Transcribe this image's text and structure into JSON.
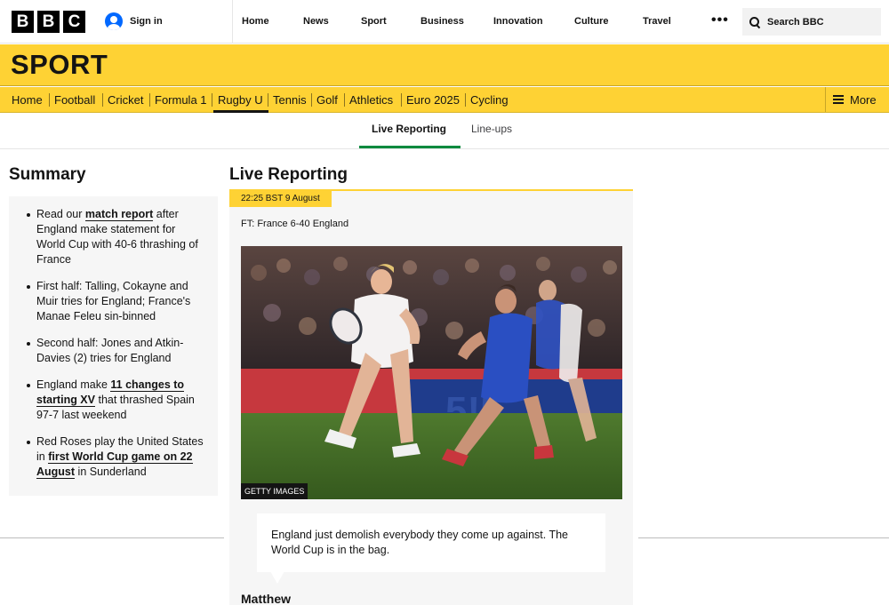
{
  "brand": {
    "logo_letters": [
      "B",
      "B",
      "C"
    ]
  },
  "account": {
    "signin_label": "Sign in"
  },
  "topnav": {
    "items": [
      "Home",
      "News",
      "Sport",
      "Business",
      "Innovation",
      "Culture",
      "Travel"
    ],
    "more_label": "•••",
    "search_label": "Search BBC"
  },
  "sport": {
    "title": "SPORT",
    "nav": [
      "Home",
      "Football",
      "Cricket",
      "Formula 1",
      "Rugby U",
      "Tennis",
      "Golf",
      "Athletics",
      "Euro 2025",
      "Cycling"
    ],
    "active_nav": "Rugby U",
    "more_label": "More"
  },
  "tabs": {
    "items": [
      "Live Reporting",
      "Line-ups"
    ],
    "active": "Live Reporting"
  },
  "summary": {
    "title": "Summary",
    "items": [
      {
        "pre": "Read our ",
        "link": "match report",
        "post": " after England make statement for World Cup with 40-6 thrashing of France"
      },
      {
        "pre": "First half: Talling, Cokayne and Muir tries for England; France's Manae Feleu sin-binned",
        "link": "",
        "post": ""
      },
      {
        "pre": "Second half: Jones and Atkin-Davies (2) tries for England",
        "link": "",
        "post": ""
      },
      {
        "pre": "England make ",
        "link": "11 changes to starting XV",
        "post": " that thrashed Spain 97-7 last weekend"
      },
      {
        "pre": "Red Roses play the United States in ",
        "link": "first World Cup game on 22 August",
        "post": " in Sunderland"
      }
    ]
  },
  "live": {
    "title": "Live Reporting",
    "timestamp": "22:25 BST 9 August",
    "headline": "FT: France 6-40 England",
    "photo_credit": "GETTY IMAGES",
    "quote": "England just demolish everybody they come up against. The World Cup is in the bag.",
    "author": "Matthew"
  }
}
